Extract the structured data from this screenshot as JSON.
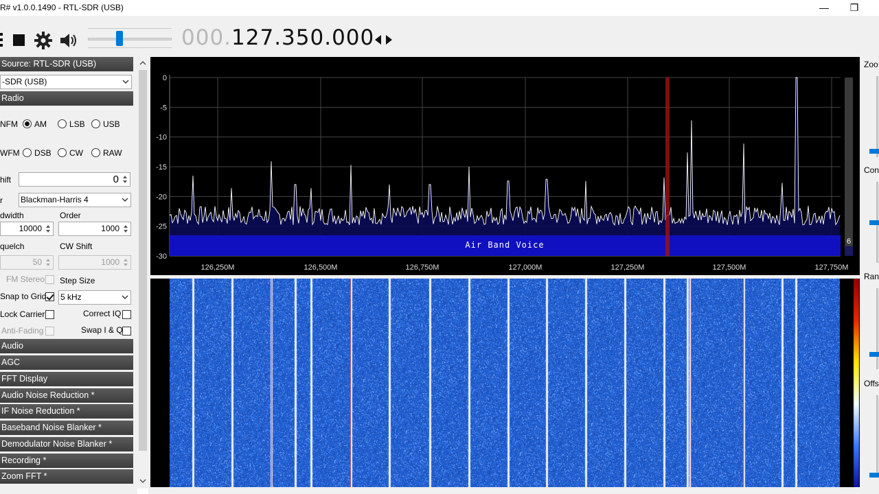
{
  "window": {
    "title": "R# v1.0.0.1490 - RTL-SDR (USB)",
    "minimize_glyph": "—",
    "maximize_glyph": "❐"
  },
  "toolbar": {
    "icons": [
      "menu-icon",
      "stop-icon",
      "gear-icon",
      "speaker-icon"
    ],
    "volume_level": 0.37,
    "frequency_dim": "000.",
    "frequency_main": "127.350.000"
  },
  "left_panel": {
    "source_header": "Source: RTL-SDR (USB)",
    "source_combo": "-SDR (USB)",
    "radio_header": "Radio",
    "modes_row1": [
      {
        "label": "NFM",
        "checked": false,
        "partial": true
      },
      {
        "label": "AM",
        "checked": true
      },
      {
        "label": "LSB",
        "checked": false
      },
      {
        "label": "USB",
        "checked": false
      }
    ],
    "modes_row2": [
      {
        "label": "WFM",
        "checked": false,
        "partial": true
      },
      {
        "label": "DSB",
        "checked": false
      },
      {
        "label": "CW",
        "checked": false
      },
      {
        "label": "RAW",
        "checked": false
      }
    ],
    "shift_label": "hift",
    "shift_value": "0",
    "filter_label": "r",
    "filter_value": "Blackman-Harris 4",
    "bandwidth_label": "dwidth",
    "bandwidth_value": "10000",
    "order_label": "Order",
    "order_value": "1000",
    "squelch_label": "quelch",
    "squelch_value": "50",
    "cwshift_label": "CW Shift",
    "cwshift_value": "1000",
    "fmstereo_label": "FM Stereo",
    "stepsize_label": "Step Size",
    "snap_label": "Snap to Grid",
    "snap_checked": true,
    "step_value": "5 kHz",
    "lockcarrier_label": "Lock Carrier",
    "correctiq_label": "Correct IQ",
    "antifading_label": "Anti-Fading",
    "swapiq_label": "Swap I & Q",
    "sections": [
      "Audio",
      "AGC",
      "FFT Display",
      "Audio Noise Reduction *",
      "IF Noise Reduction *",
      "Baseband Noise Blanker *",
      "Demodulator Noise Blanker *",
      "Recording *",
      "Zoom FFT *"
    ]
  },
  "spectrum": {
    "y_ticks": [
      "0",
      "-5",
      "-10",
      "-15",
      "-20",
      "-25",
      "-30"
    ],
    "x_ticks": [
      "126,250M",
      "126,500M",
      "126,750M",
      "127,000M",
      "127,250M",
      "127,500M",
      "127,750M"
    ],
    "band_label": "Air Band Voice",
    "band_color": "#1010c0",
    "trace_color": "#ffffff",
    "fill_color": "#0a0a55",
    "marker_color": "#a01010",
    "side_value": "6"
  },
  "right_panel": {
    "labels": [
      "Zoo",
      "Cont",
      "Ran",
      "Offs"
    ]
  }
}
